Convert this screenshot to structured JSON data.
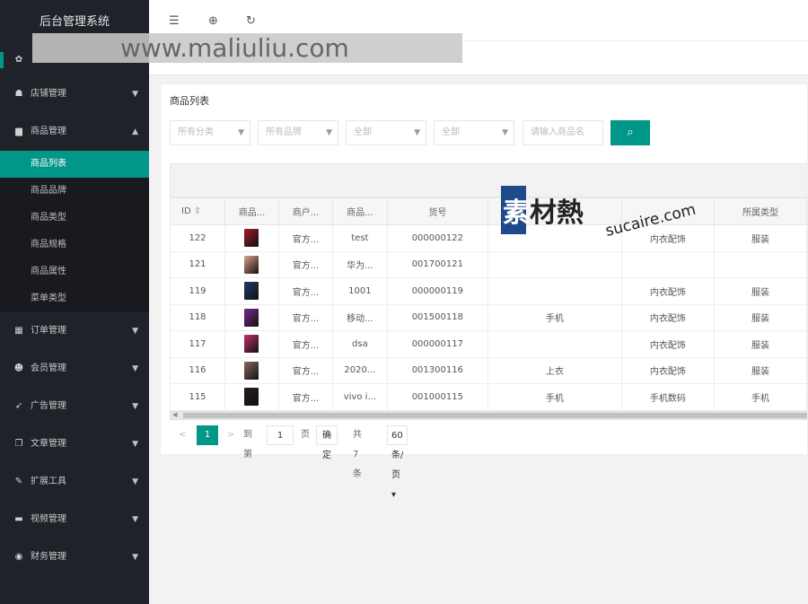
{
  "app_title": "后台管理系统",
  "watermark_text": "www.maliuliu.com",
  "watermark_logo": "素材熱 sucaire.com",
  "sidebar": {
    "items": [
      {
        "label": "",
        "icon": "gear-icon"
      },
      {
        "label": "店铺管理",
        "icon": "store-icon"
      },
      {
        "label": "商品管理",
        "icon": "chart-icon"
      },
      {
        "label": "订单管理",
        "icon": "calendar-icon"
      },
      {
        "label": "会员管理",
        "icon": "users-icon"
      },
      {
        "label": "广告管理",
        "icon": "rocket-icon"
      },
      {
        "label": "文章管理",
        "icon": "copy-icon"
      },
      {
        "label": "扩展工具",
        "icon": "wrench-icon"
      },
      {
        "label": "视频管理",
        "icon": "camera-icon"
      },
      {
        "label": "财务管理",
        "icon": "coin-icon"
      }
    ],
    "sub_items": [
      "商品列表",
      "商品品牌",
      "商品类型",
      "商品规格",
      "商品属性",
      "菜单类型"
    ]
  },
  "header_icons": [
    "menu-fold-icon",
    "globe-icon",
    "refresh-icon"
  ],
  "card": {
    "title": "商品列表",
    "filters": [
      {
        "placeholder": "所有分类"
      },
      {
        "placeholder": "所有品牌"
      },
      {
        "placeholder": "全部"
      },
      {
        "placeholder": "全部"
      }
    ],
    "search_placeholder": "请输入商品名"
  },
  "table": {
    "headers": [
      "ID",
      "商品...",
      "商户...",
      "商品...",
      "货号",
      "",
      "",
      "所属类型"
    ],
    "rows": [
      {
        "id": "122",
        "merchant": "官方...",
        "name": "test",
        "sku": "000000122",
        "col6": "",
        "col7": "内衣配饰",
        "type": "服装",
        "img": "#a01a2a"
      },
      {
        "id": "121",
        "merchant": "官方...",
        "name": "华为...",
        "sku": "001700121",
        "col6": "",
        "col7": "",
        "type": "",
        "img": "#e0a08a"
      },
      {
        "id": "119",
        "merchant": "官方...",
        "name": "1001",
        "sku": "000000119",
        "col6": "",
        "col7": "内衣配饰",
        "type": "服装",
        "img": "#1f3a6a"
      },
      {
        "id": "118",
        "merchant": "官方...",
        "name": "移动...",
        "sku": "001500118",
        "col6": "手机",
        "col7": "内衣配饰",
        "type": "服装",
        "img": "#7a2a8a"
      },
      {
        "id": "117",
        "merchant": "官方...",
        "name": "dsa",
        "sku": "000000117",
        "col6": "",
        "col7": "内衣配饰",
        "type": "服装",
        "img": "#c03070"
      },
      {
        "id": "116",
        "merchant": "官方...",
        "name": "2020...",
        "sku": "001300116",
        "col6": "上衣",
        "col7": "内衣配饰",
        "type": "服装",
        "img": "#8a6a5a"
      },
      {
        "id": "115",
        "merchant": "官方...",
        "name": "vivo i...",
        "sku": "001000115",
        "col6": "手机",
        "col7": "手机数码",
        "type": "手机",
        "img": "#2a1a1a"
      }
    ]
  },
  "pager": {
    "prev": "<",
    "current": "1",
    "next": ">",
    "goto_label": "到第",
    "goto_value": "1",
    "page_label": "页",
    "ok_label": "确定",
    "total": "共 7 条",
    "size": "60 条/页"
  }
}
